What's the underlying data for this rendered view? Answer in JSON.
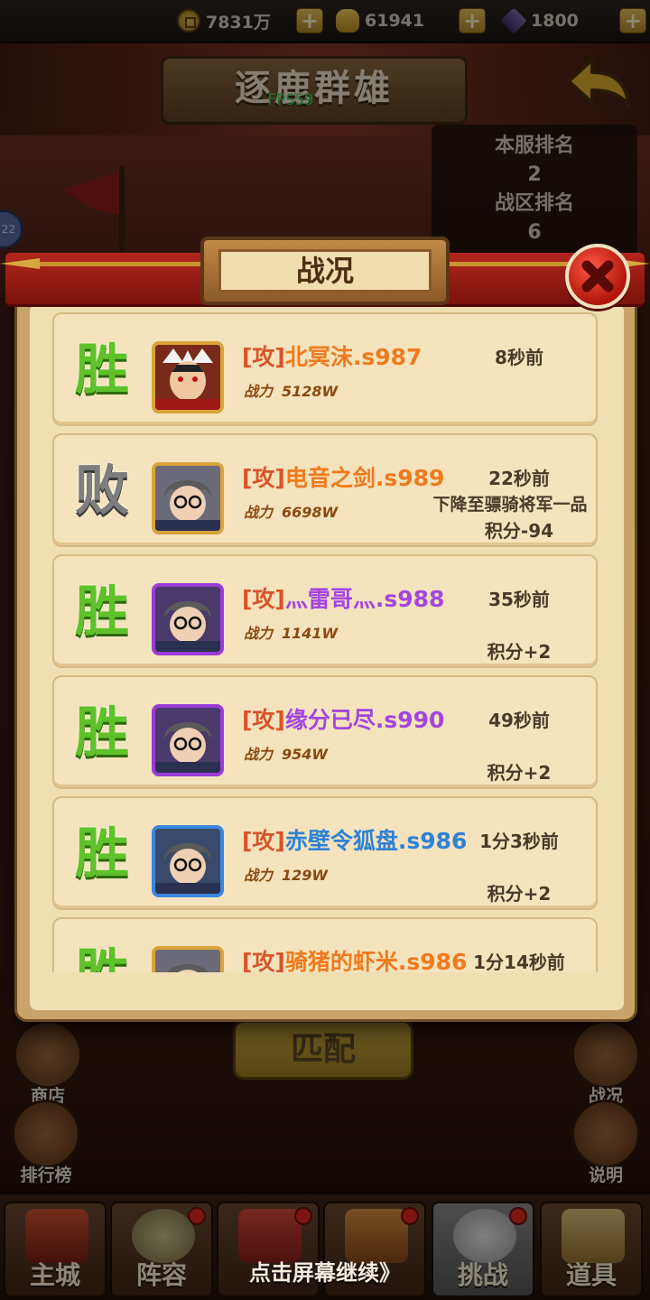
{
  "resources": {
    "copper": "7831万",
    "ingot": "61941",
    "token": "1800"
  },
  "header": {
    "title": "逐鹿群雄",
    "fps": "FPS59"
  },
  "rank_panel": {
    "server_label": "本服排名",
    "server_value": "2",
    "zone_label": "战区排名",
    "zone_value": "6"
  },
  "side_buttons": {
    "shop": "商店",
    "leaderboard": "排行榜",
    "battle_report": "战况",
    "help": "说明",
    "match": "匹配"
  },
  "dialog": {
    "title": "战况",
    "entries": [
      {
        "result": "胜",
        "outcome": "win",
        "tag": "[攻]",
        "name": "北冥沫.s987",
        "name_color": "orange",
        "power_label": "战力",
        "power": "5128W",
        "time": "8秒前",
        "extra": "",
        "score": "",
        "avatar_frame": "gold"
      },
      {
        "result": "败",
        "outcome": "lose",
        "tag": "[攻]",
        "name": "电音之剑.s989",
        "name_color": "orange",
        "power_label": "战力",
        "power": "6698W",
        "time": "22秒前",
        "extra": "下降至骠骑将军一品",
        "score": "积分-94",
        "avatar_frame": "gold"
      },
      {
        "result": "胜",
        "outcome": "win",
        "tag": "[攻]",
        "name": "灬雷哥灬.s988",
        "name_color": "purple",
        "power_label": "战力",
        "power": "1141W",
        "time": "35秒前",
        "extra": "",
        "score": "积分+2",
        "avatar_frame": "purple"
      },
      {
        "result": "胜",
        "outcome": "win",
        "tag": "[攻]",
        "name": "缘分已尽.s990",
        "name_color": "purple",
        "power_label": "战力",
        "power": "954W",
        "time": "49秒前",
        "extra": "",
        "score": "积分+2",
        "avatar_frame": "purple"
      },
      {
        "result": "胜",
        "outcome": "win",
        "tag": "[攻]",
        "name": "赤壁令狐盘.s986",
        "name_color": "blue",
        "power_label": "战力",
        "power": "129W",
        "time": "1分3秒前",
        "extra": "",
        "score": "积分+2",
        "avatar_frame": "blue"
      },
      {
        "result": "胜",
        "outcome": "win",
        "tag": "[攻]",
        "name": "骑猪的虾米.s986",
        "name_color": "orange",
        "power_label": "战力",
        "power": "",
        "time": "1分14秒前",
        "extra": "",
        "score": "",
        "avatar_frame": "gold"
      }
    ]
  },
  "bottom_nav": {
    "items": [
      "主城",
      "阵容",
      "",
      "",
      "挑战",
      "道具"
    ],
    "tap_hint": "点击屏幕继续》"
  },
  "colors": {
    "win": "#5fc22a",
    "lose": "#7e7e7e",
    "name_orange": "#f07a1e",
    "name_purple": "#a445e0",
    "name_blue": "#2f82d6",
    "attack_tag": "#d9532a"
  }
}
